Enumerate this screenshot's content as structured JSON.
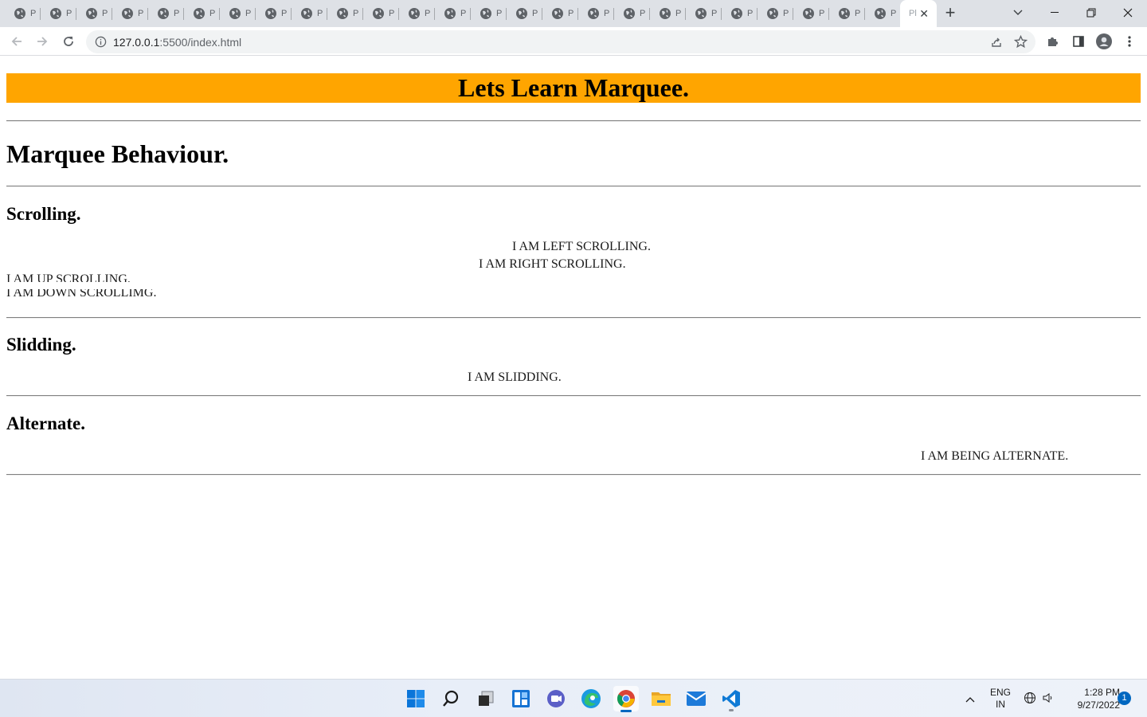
{
  "browser": {
    "background_tab_label": "P",
    "active_tab_label": "Pl",
    "url_host": "127.0.0.1",
    "url_rest": ":5500/index.html"
  },
  "page": {
    "banner": "Lets Learn Marquee.",
    "banner_color": "#ffa500",
    "behaviour_heading": "Marquee Behaviour.",
    "scrolling_heading": "Scrolling.",
    "marquee_left": "I AM LEFT SCROLLING.",
    "marquee_right": "I AM RIGHT SCROLLING.",
    "marquee_up": "I AM UP SCROLLING.",
    "marquee_down": "I AM DOWN SCROLLIMG.",
    "slidding_heading": "Slidding.",
    "marquee_slide": "I AM SLIDDING.",
    "alternate_heading": "Alternate.",
    "marquee_alternate": "I AM BEING ALTERNATE."
  },
  "taskbar": {
    "lang_line1": "ENG",
    "lang_line2": "IN",
    "time": "1:28 PM",
    "date": "9/27/2022",
    "notification_count": "1",
    "accent": "#0067c0"
  }
}
